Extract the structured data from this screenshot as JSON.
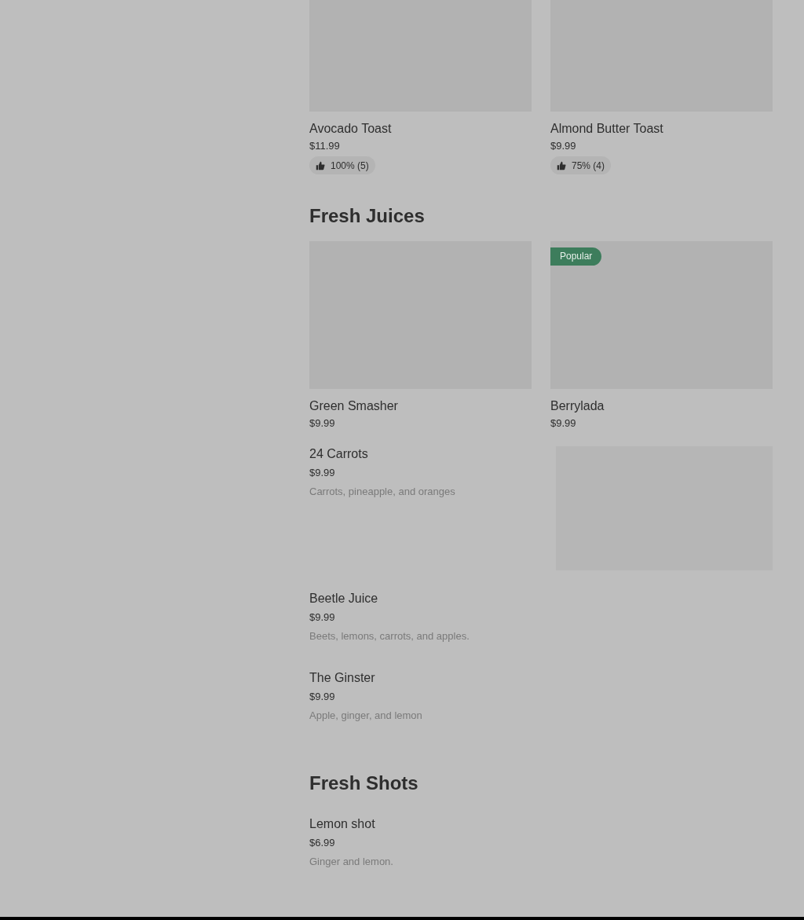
{
  "sections": [
    {
      "items": [
        {
          "kind": "card",
          "name": "Avocado Toast",
          "price": "$11.99",
          "rating": "100% (5)"
        },
        {
          "kind": "card",
          "name": "Almond Butter Toast",
          "price": "$9.99",
          "rating": "75% (4)"
        }
      ]
    },
    {
      "title": "Fresh Juices",
      "items": [
        {
          "kind": "card",
          "name": "Green Smasher",
          "price": "$9.99"
        },
        {
          "kind": "card",
          "name": "Berrylada",
          "price": "$9.99",
          "badge": "Popular"
        },
        {
          "kind": "row",
          "name": "24 Carrots",
          "price": "$9.99",
          "description": "Carrots, pineapple, and oranges",
          "has_image": true
        },
        {
          "kind": "row",
          "name": "Beetle Juice",
          "price": "$9.99",
          "description": "Beets, lemons, carrots, and apples.",
          "has_image": false
        },
        {
          "kind": "row",
          "name": "The Ginster",
          "price": "$9.99",
          "description": "Apple, ginger, and lemon",
          "has_image": false
        }
      ]
    },
    {
      "title": "Fresh Shots",
      "items": [
        {
          "kind": "row",
          "name": "Lemon shot",
          "price": "$6.99",
          "description": "Ginger and lemon.",
          "has_image": false
        }
      ]
    }
  ]
}
